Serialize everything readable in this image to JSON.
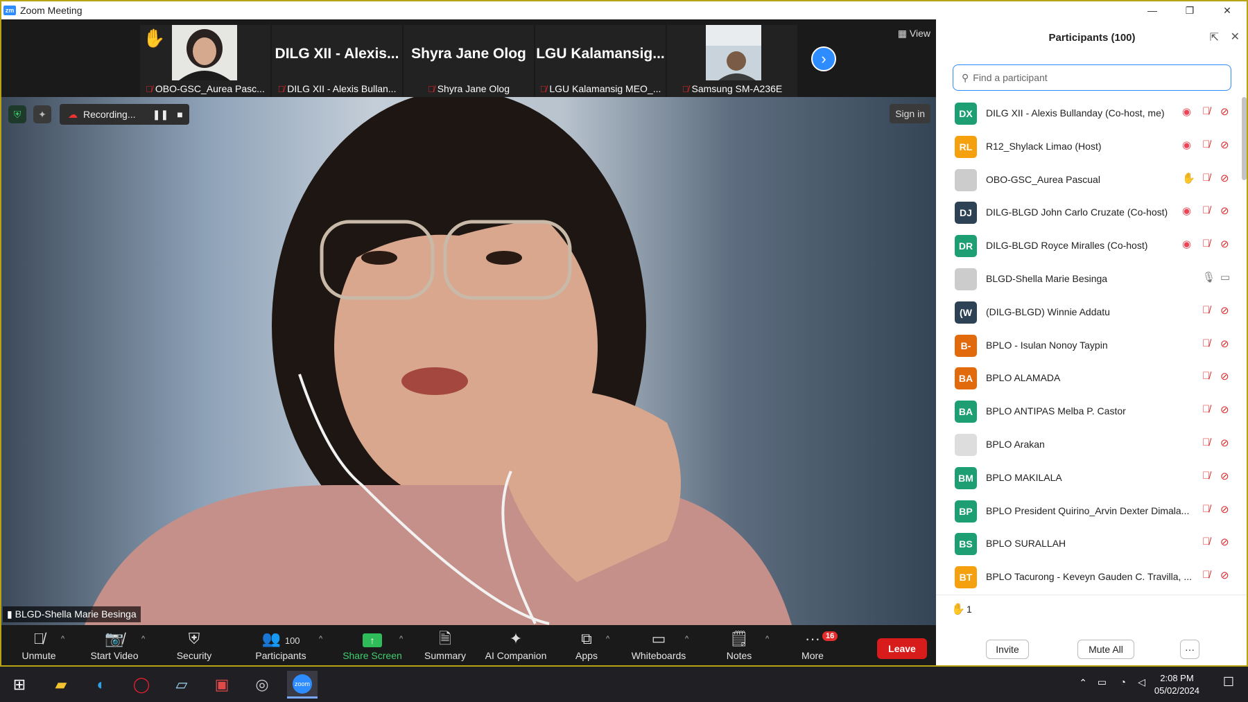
{
  "window": {
    "title": "Zoom Meeting",
    "logo": "zm"
  },
  "strip": {
    "tiles": [
      {
        "name": "OBO-GSC_Aurea Pasc...",
        "big": ""
      },
      {
        "name": "DILG XII - Alexis Bullan...",
        "big": "DILG XII - Alexis..."
      },
      {
        "name": "Shyra Jane Olog",
        "big": "Shyra Jane Olog"
      },
      {
        "name": "LGU Kalamansig MEO_...",
        "big": "LGU Kalamansig..."
      },
      {
        "name": "Samsung SM-A236E",
        "big": ""
      }
    ],
    "view_label": "View"
  },
  "video": {
    "recording_label": "Recording...",
    "sign_in": "Sign in",
    "speaker": "BLGD-Shella Marie Besinga"
  },
  "toolbar": {
    "unmute": "Unmute",
    "start_video": "Start Video",
    "security": "Security",
    "participants": "Participants",
    "participants_count": "100",
    "share_screen": "Share Screen",
    "summary": "Summary",
    "ai_companion": "AI Companion",
    "apps": "Apps",
    "whiteboards": "Whiteboards",
    "notes": "Notes",
    "more": "More",
    "more_badge": "16",
    "leave": "Leave"
  },
  "panel": {
    "title": "Participants (100)",
    "search_placeholder": "Find a participant",
    "participants": [
      {
        "initials": "DX",
        "color": "#1d9e73",
        "name": "DILG XII - Alexis Bullanday (Co-host, me)",
        "status": "rec"
      },
      {
        "initials": "RL",
        "color": "#f5a00e",
        "name": "R12_Shylack Limao (Host)",
        "status": "rec"
      },
      {
        "initials": "",
        "color": "#ccc",
        "name": "OBO-GSC_Aurea Pascual",
        "status": "hand"
      },
      {
        "initials": "DJ",
        "color": "#2e4256",
        "name": "DILG-BLGD John Carlo Cruzate (Co-host)",
        "status": "rec"
      },
      {
        "initials": "DR",
        "color": "#1d9e73",
        "name": "DILG-BLGD Royce Miralles (Co-host)",
        "status": "rec"
      },
      {
        "initials": "",
        "color": "#ccc",
        "name": "BLGD-Shella Marie Besinga",
        "status": "live"
      },
      {
        "initials": "(W",
        "color": "#2e4256",
        "name": "(DILG-BLGD) Winnie Addatu",
        "status": ""
      },
      {
        "initials": "B-",
        "color": "#e06a0c",
        "name": "BPLO - Isulan Nonoy Taypin",
        "status": ""
      },
      {
        "initials": "BA",
        "color": "#e06a0c",
        "name": "BPLO ALAMADA",
        "status": ""
      },
      {
        "initials": "BA",
        "color": "#1d9e73",
        "name": "BPLO ANTIPAS Melba P. Castor",
        "status": ""
      },
      {
        "initials": "",
        "color": "#ddd",
        "name": "BPLO Arakan",
        "status": ""
      },
      {
        "initials": "BM",
        "color": "#1d9e73",
        "name": "BPLO MAKILALA",
        "status": ""
      },
      {
        "initials": "BP",
        "color": "#1d9e73",
        "name": "BPLO President Quirino_Arvin Dexter Dimala...",
        "status": ""
      },
      {
        "initials": "BS",
        "color": "#1d9e73",
        "name": "BPLO SURALLAH",
        "status": ""
      },
      {
        "initials": "BT",
        "color": "#f5a00e",
        "name": "BPLO Tacurong - Keveyn Gauden C. Travilla, ...",
        "status": ""
      }
    ],
    "hands_count": "1",
    "invite": "Invite",
    "mute_all": "Mute All",
    "more": "···"
  },
  "taskbar": {
    "time": "2:08 PM",
    "date": "05/02/2024",
    "zoom_label": "zoom"
  }
}
